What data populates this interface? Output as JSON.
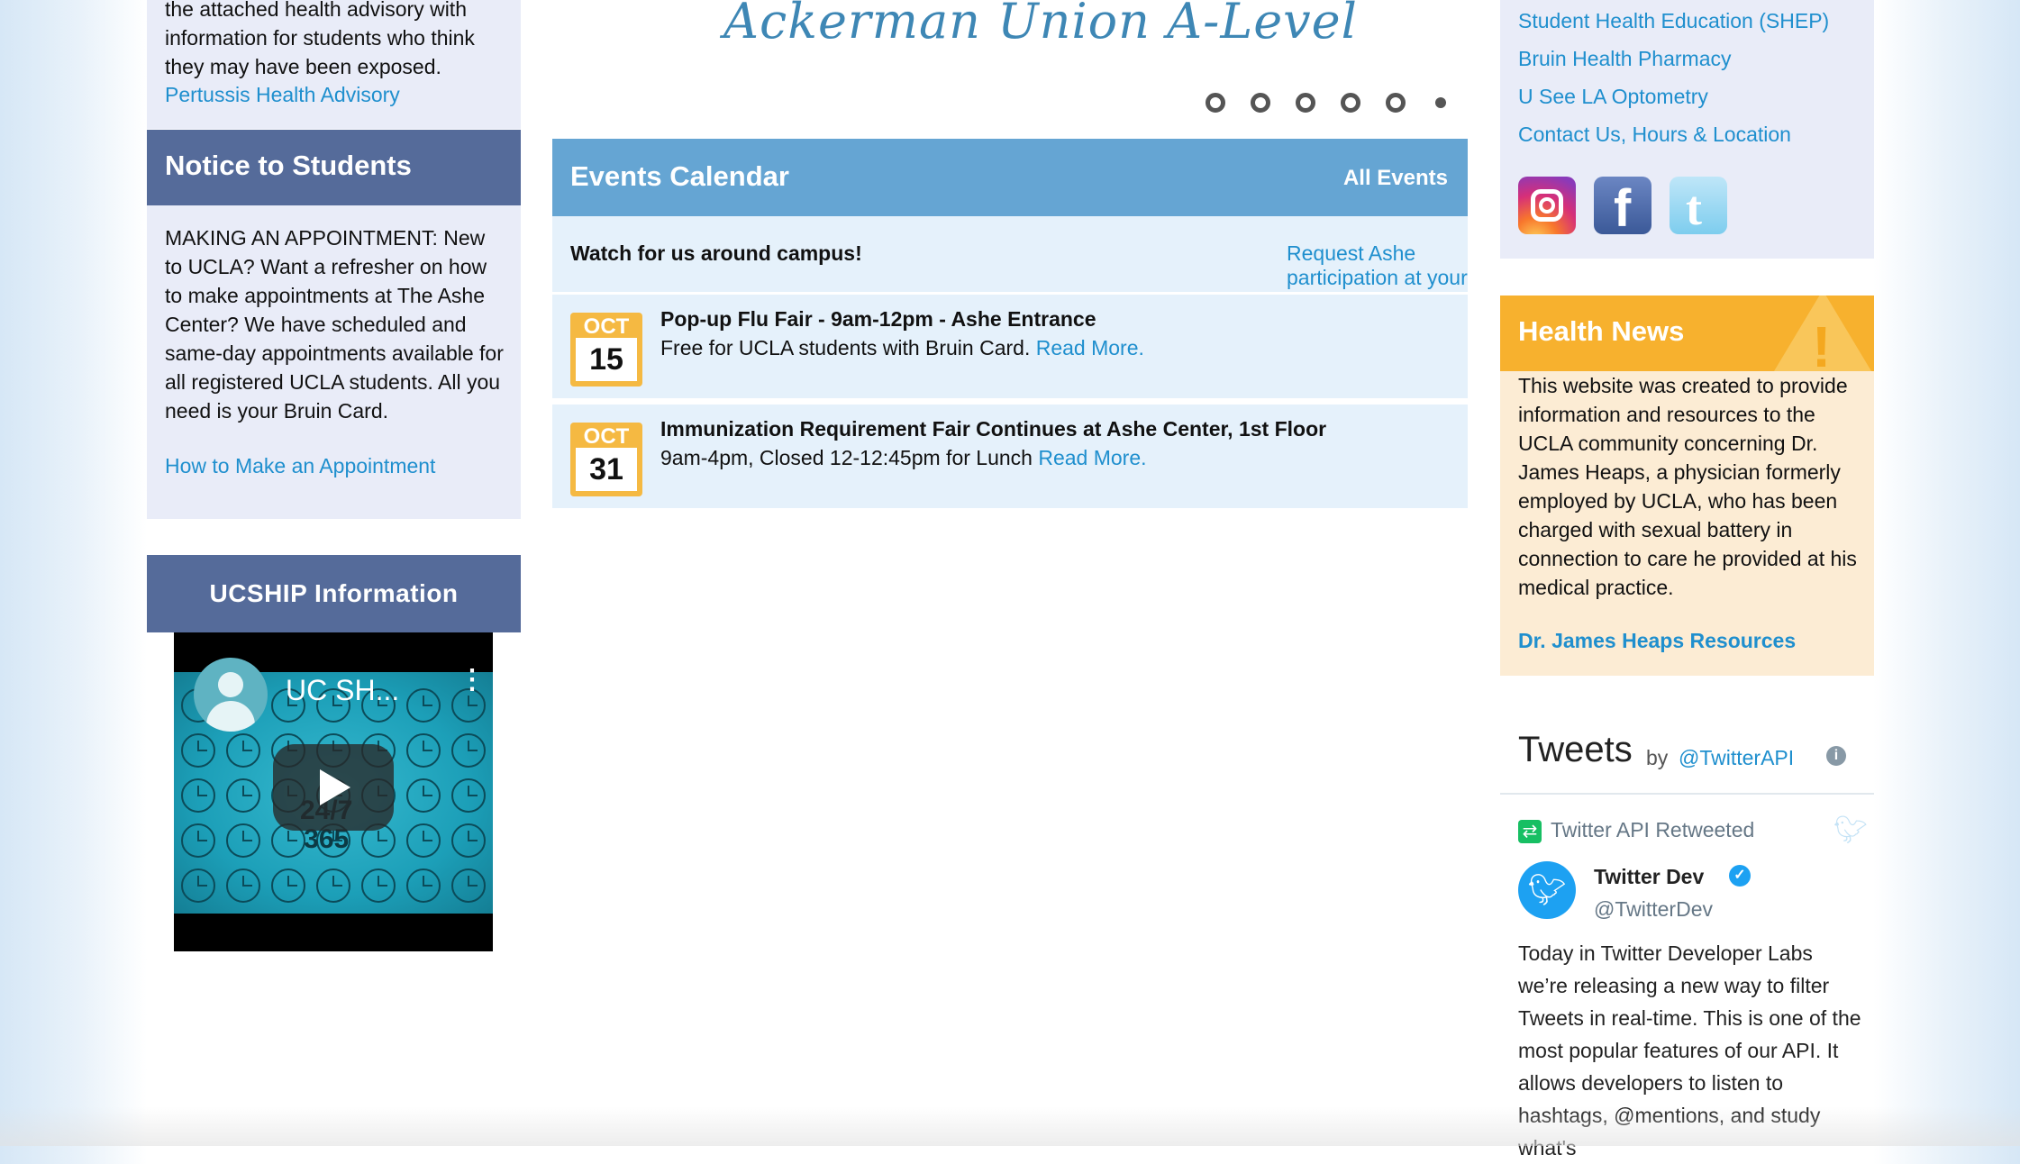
{
  "left": {
    "advisory": {
      "text": "the attached health advisory with information for students who think they may have been exposed.",
      "link": "Pertussis Health Advisory"
    },
    "notice": {
      "title": "Notice to Students",
      "text": "MAKING AN APPOINTMENT: New to UCLA? Want a refresher on how to make appointments at The Ashe Center? We have scheduled and same-day appointments available for all registered UCLA students. All you need is your Bruin Card.",
      "link": "How to Make an Appointment"
    },
    "ucship": {
      "title": "UCSHIP Information",
      "video_title": "UC SH...",
      "video_overlay": "24/7\n365"
    }
  },
  "middle": {
    "banner_title": "Ackerman Union A-Level",
    "slider_dots": 6,
    "active_dot": 6,
    "events": {
      "title": "Events Calendar",
      "all_link": "All Events",
      "intro_bold": "Watch for us around campus!",
      "intro_link": "Request Ashe participation at your next event.",
      "items": [
        {
          "month": "OCT",
          "day": "15",
          "title": "Pop-up Flu Fair - 9am-12pm - Ashe Entrance",
          "desc": "Free for UCLA students with Bruin Card.",
          "link": "Read More."
        },
        {
          "month": "OCT",
          "day": "31",
          "title": "Immunization Requirement Fair Continues at Ashe Center, 1st Floor",
          "desc": "9am-4pm, Closed 12-12:45pm for Lunch",
          "link": "Read More."
        }
      ]
    }
  },
  "right": {
    "links": [
      "Student Health Education (SHEP)",
      "Bruin Health Pharmacy",
      "U See LA Optometry",
      "Contact Us, Hours & Location"
    ],
    "social": [
      "instagram-icon",
      "facebook-icon",
      "twitter-icon"
    ],
    "news": {
      "title": "Health News",
      "text": "This website was created to provide information and resources to the UCLA community concerning Dr. James Heaps, a physician formerly employed by UCLA, who has been charged with sexual battery in connection to care he provided at his medical practice.",
      "link": "Dr. James Heaps Resources"
    },
    "tweets": {
      "header": "Tweets",
      "by": "by",
      "handle": "@TwitterAPI",
      "retweet_label": "Twitter API Retweeted",
      "author_name": "Twitter Dev",
      "author_handle": "@TwitterDev",
      "body": "Today in Twitter Developer Labs we’re releasing a new way to filter Tweets in real-time. This is one of the most popular features of our API. It allows developers to listen to hashtags, @mentions, and study what's"
    }
  },
  "colors": {
    "link": "#1f8fce",
    "panel_header": "#556b9a",
    "events_header": "#65a5d3",
    "news_header": "#f7b12e",
    "calendar": "#f5b942"
  }
}
